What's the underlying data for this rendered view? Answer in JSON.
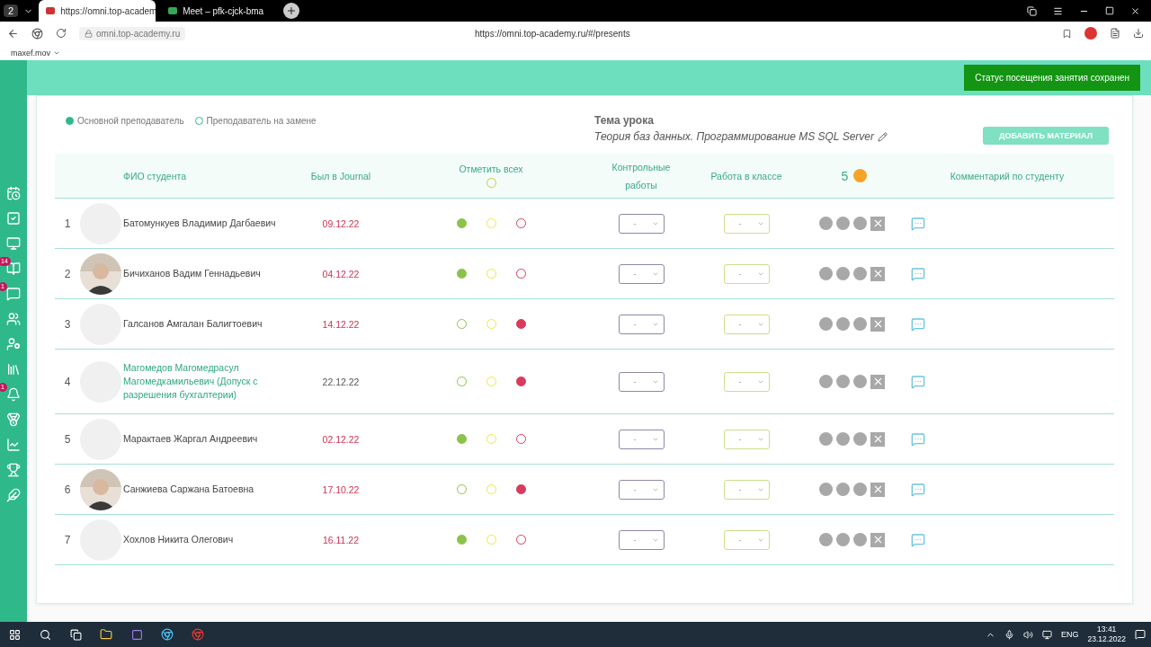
{
  "browser": {
    "tab_count": "2",
    "tabs": [
      {
        "title": "https://omni.top-academ",
        "selected": true
      },
      {
        "title": "Meet – pfk-cjck-bma",
        "selected": false
      }
    ],
    "address": "omni.top-academy.ru",
    "page_url": "https://omni.top-academy.ru/#/presents",
    "bookmark": "maxef.mov"
  },
  "sidebar": {
    "items": [
      {
        "kind": "calendar"
      },
      {
        "kind": "tasks"
      },
      {
        "kind": "monitor"
      },
      {
        "kind": "book",
        "badge": "14"
      },
      {
        "kind": "chat",
        "badge": "1"
      },
      {
        "kind": "group"
      },
      {
        "kind": "teacher"
      },
      {
        "kind": "library"
      },
      {
        "kind": "bell",
        "badge": "1"
      },
      {
        "kind": "medal"
      },
      {
        "kind": "chart"
      },
      {
        "kind": "trophy"
      },
      {
        "kind": "feather"
      }
    ]
  },
  "toast": "Статус посещения занятия сохранен",
  "legend": [
    {
      "label": "Основной преподаватель",
      "selected": true
    },
    {
      "label": "Преподаватель на замене",
      "selected": false
    }
  ],
  "topic": {
    "label": "Тема урока",
    "value": "Теория баз данных. Программирование MS SQL Server"
  },
  "add_button": "ДОБАВИТЬ МАТЕРИАЛ",
  "table": {
    "columns": [
      {
        "kind": "text",
        "label": "ФИО студента"
      },
      {
        "kind": "text",
        "label": "Был в Journal"
      },
      {
        "kind": "markall",
        "label": "Отметить всех",
        "selected": false
      },
      {
        "kind": "text",
        "label": "Контрольные работы"
      },
      {
        "kind": "text",
        "label": "Работа в классе"
      },
      {
        "kind": "coins",
        "label": "5"
      },
      {
        "kind": "text",
        "label": "Комментарий по студенту"
      }
    ],
    "rows": [
      {
        "num": "1",
        "has_photo": false,
        "name": "Батомункуев Владимир Дагбаевич",
        "name_highlighted": false,
        "date": "09.12.22",
        "date_highlighted": true,
        "present": true,
        "late": false,
        "absent": false,
        "test": "-",
        "classwork": "-"
      },
      {
        "num": "2",
        "has_photo": true,
        "name": "Бичиханов Вадим Геннадьевич",
        "name_highlighted": false,
        "date": "04.12.22",
        "date_highlighted": true,
        "present": true,
        "late": false,
        "absent": false,
        "test": "-",
        "classwork": "-"
      },
      {
        "num": "3",
        "has_photo": false,
        "name": "Галсанов Амгалан Балигтоевич",
        "name_highlighted": false,
        "date": "14.12.22",
        "date_highlighted": true,
        "present": false,
        "late": false,
        "absent": true,
        "test": "-",
        "classwork": "-"
      },
      {
        "num": "4",
        "has_photo": false,
        "name": "Магомедов Магомедрасул Магомедкамильевич (Допуск с разрешения бухгалтерии)",
        "name_highlighted": true,
        "date": "22.12.22",
        "date_highlighted": false,
        "present": false,
        "late": false,
        "absent": true,
        "test": "-",
        "classwork": "-"
      },
      {
        "num": "5",
        "has_photo": false,
        "name": "Марактаев Жаргал Андреевич",
        "name_highlighted": false,
        "date": "02.12.22",
        "date_highlighted": true,
        "present": true,
        "late": false,
        "absent": false,
        "test": "-",
        "classwork": "-"
      },
      {
        "num": "6",
        "has_photo": true,
        "name": "Санжиева Саржана Батоевна",
        "name_highlighted": false,
        "date": "17.10.22",
        "date_highlighted": true,
        "present": false,
        "late": false,
        "absent": true,
        "test": "-",
        "classwork": "-"
      },
      {
        "num": "7",
        "has_photo": false,
        "name": "Хохлов Никита Олегович",
        "name_highlighted": false,
        "date": "16.11.22",
        "date_highlighted": true,
        "present": true,
        "late": false,
        "absent": false,
        "test": "-",
        "classwork": "-"
      }
    ]
  },
  "taskbar": {
    "language": "ENG",
    "time": "13:41",
    "date": "23.12.2022"
  }
}
